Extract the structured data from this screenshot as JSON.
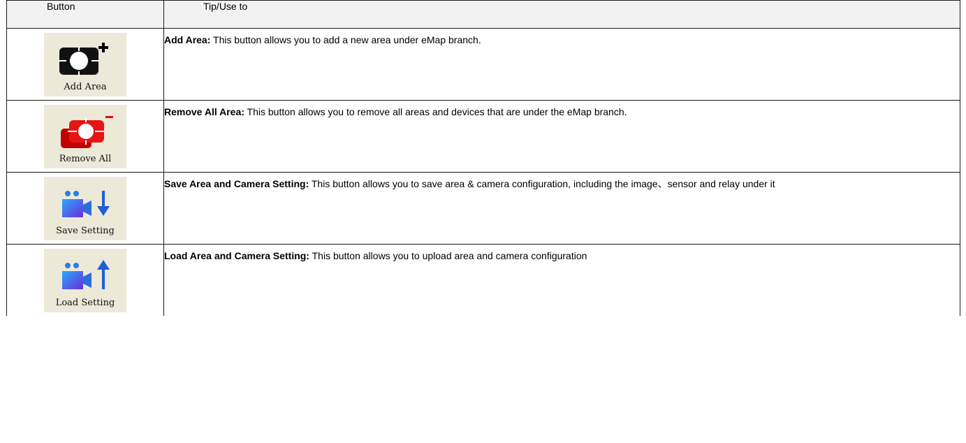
{
  "table": {
    "header": {
      "button": "Button",
      "tip": "Tip/Use to"
    },
    "rows": [
      {
        "button_label": "Add Area",
        "icon": "add-area-icon",
        "icon_color": "#111111",
        "title": "Add Area:",
        "description": " This button allows you to add a new area under eMap branch."
      },
      {
        "button_label": "Remove All",
        "icon": "remove-all-area-icon",
        "icon_color": "#e01010",
        "title": "Remove All Area:",
        "description": " This button allows you to remove all areas and devices that are under the eMap branch."
      },
      {
        "button_label": "Save Setting",
        "icon": "save-setting-icon",
        "icon_color": "#1f5fd6",
        "title": "Save Area and Camera Setting:",
        "description": " This button allows you to save area & camera configuration, including the image、sensor and relay under it"
      },
      {
        "button_label": "Load Setting",
        "icon": "load-setting-icon",
        "icon_color": "#1f5fd6",
        "title": "Load Area and Camera Setting:",
        "description": " This button allows you to upload area and camera configuration"
      }
    ]
  }
}
